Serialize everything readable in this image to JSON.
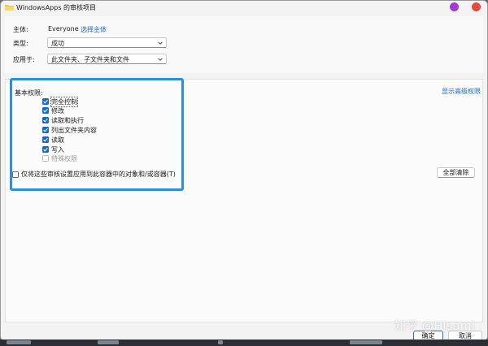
{
  "window": {
    "title": "WindowsApps 的审核项目"
  },
  "principal": {
    "label": "主体:",
    "value": "Everyone",
    "select_link": "选择主体"
  },
  "type": {
    "label": "类型:",
    "value": "成功"
  },
  "applies_to": {
    "label": "应用于:",
    "value": "此文件夹、子文件夹和文件"
  },
  "permissions": {
    "heading": "基本权限:",
    "advanced_link": "显示高级权限",
    "items": [
      {
        "label": "完全控制",
        "checked": true,
        "enabled": true
      },
      {
        "label": "修改",
        "checked": true,
        "enabled": true
      },
      {
        "label": "读取和执行",
        "checked": true,
        "enabled": true
      },
      {
        "label": "列出文件夹内容",
        "checked": true,
        "enabled": true
      },
      {
        "label": "读取",
        "checked": true,
        "enabled": true
      },
      {
        "label": "写入",
        "checked": true,
        "enabled": true
      },
      {
        "label": "特殊权限",
        "checked": false,
        "enabled": false
      }
    ],
    "apply_only_label": "仅将这些审核设置应用到此容器中的对象和/或容器(T)",
    "clear_all": "全部清除"
  },
  "footer": {
    "ok": "确定",
    "cancel": "取消"
  },
  "watermark": "知乎 @Hisami",
  "colors": {
    "accent": "#1a6fc8",
    "highlight_box": "#2d8fd8",
    "link": "#1b6ac9"
  }
}
